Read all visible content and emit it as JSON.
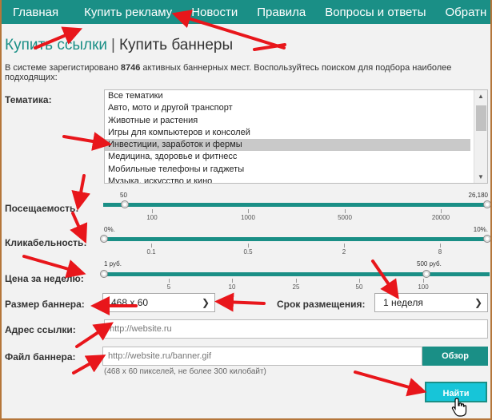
{
  "nav": {
    "items": [
      "Главная",
      "Купить рекламу",
      "Новости",
      "Правила",
      "Вопросы и ответы",
      "Обратн"
    ]
  },
  "heading": {
    "link": "Купить ссылки",
    "separator": "|",
    "current": "Купить баннеры"
  },
  "intro": {
    "before": "В системе зарегистировано ",
    "count": "8746",
    "after": " активных баннерных мест. Воспользуйтесь поиском для подбора наиболее подходящих:"
  },
  "topic": {
    "label": "Тематика:",
    "options": [
      "Все тематики",
      "Авто, мото и другой транспорт",
      "Животные и растения",
      "Игры для компьютеров и консолей",
      "Инвестиции, заработок и фермы",
      "Медицина, здоровье и фитнесс",
      "Мобильные телефоны и гаджеты",
      "Музыка, искусство и кино"
    ],
    "selected_index": 4
  },
  "traffic": {
    "label": "Посещаемость:",
    "min_value": "50",
    "max_value": "26,180",
    "ticks": [
      "100",
      "1000",
      "5000",
      "20000"
    ]
  },
  "ctr": {
    "label": "Кликабельность:",
    "min_value": "0%.",
    "max_value": "10%.",
    "ticks": [
      "0.1",
      "0.5",
      "2",
      "8"
    ]
  },
  "price": {
    "label": "Цена за неделю:",
    "min_value": "1 руб.",
    "max_value": "500 руб.",
    "ticks": [
      "5",
      "10",
      "25",
      "50",
      "100"
    ]
  },
  "banner_size": {
    "label": "Размер баннера:",
    "value": "468 x 60"
  },
  "duration": {
    "label": "Срок размещения:",
    "value": "1 неделя"
  },
  "url": {
    "label": "Адрес ссылки:",
    "placeholder": "http://website.ru"
  },
  "file": {
    "label": "Файл баннера:",
    "placeholder": "http://website.ru/banner.gif",
    "browse_label": "Обзор",
    "hint": "(468 x 60 пикселей, не более 300 килобайт)"
  },
  "search_button": "Найти",
  "colors": {
    "accent": "#1a8f86",
    "button": "#17c5d8",
    "annotation": "#e8161b",
    "frame": "#b5763a"
  }
}
